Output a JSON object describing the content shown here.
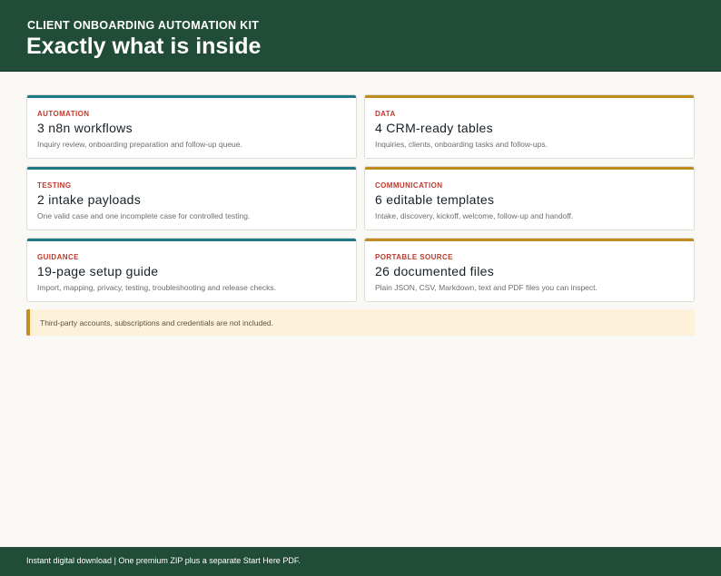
{
  "header": {
    "eyebrow": "CLIENT ONBOARDING AUTOMATION KIT",
    "title": "Exactly what is inside"
  },
  "colors": {
    "header_bg": "#214c38",
    "teal_accent": "#1d7785",
    "gold_accent": "#c08a1e",
    "category_red": "#c0392b",
    "note_bg": "#fdf2d9"
  },
  "cards": [
    {
      "category": "AUTOMATION",
      "headline": "3 n8n workflows",
      "description": "Inquiry review, onboarding preparation and follow-up queue.",
      "accent": "teal"
    },
    {
      "category": "DATA",
      "headline": "4 CRM-ready tables",
      "description": "Inquiries, clients, onboarding tasks and follow-ups.",
      "accent": "gold"
    },
    {
      "category": "TESTING",
      "headline": "2 intake payloads",
      "description": "One valid case and one incomplete case for controlled testing.",
      "accent": "teal"
    },
    {
      "category": "COMMUNICATION",
      "headline": "6 editable templates",
      "description": "Intake, discovery, kickoff, welcome, follow-up and handoff.",
      "accent": "gold"
    },
    {
      "category": "GUIDANCE",
      "headline": "19-page setup guide",
      "description": "Import, mapping, privacy, testing, troubleshooting and release checks.",
      "accent": "teal"
    },
    {
      "category": "PORTABLE SOURCE",
      "headline": "26 documented files",
      "description": "Plain JSON, CSV, Markdown, text and PDF files you can inspect.",
      "accent": "gold"
    }
  ],
  "note": {
    "text": "Third-party accounts, subscriptions and credentials are not included."
  },
  "footer": {
    "text": "Instant digital download | One premium ZIP plus a separate Start Here PDF."
  }
}
